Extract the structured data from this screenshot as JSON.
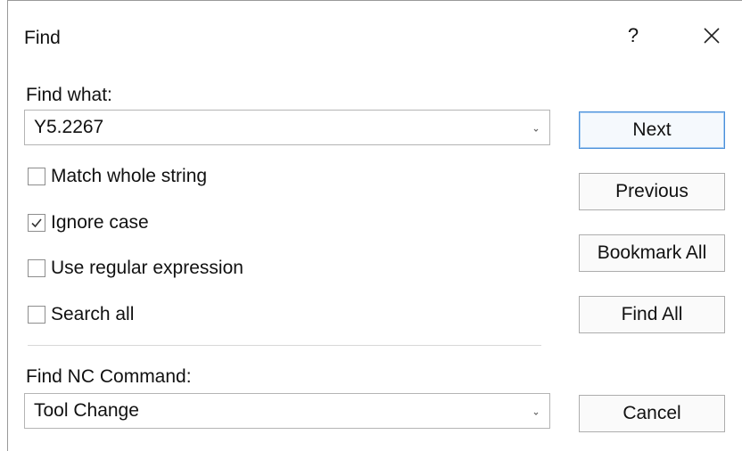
{
  "dialog": {
    "title": "Find",
    "help_label": "?"
  },
  "find_what": {
    "label": "Find what:",
    "value": "Y5.2267"
  },
  "options": [
    {
      "label": "Match whole string",
      "checked": false
    },
    {
      "label": "Ignore case",
      "checked": true
    },
    {
      "label": "Use regular expression",
      "checked": false
    },
    {
      "label": "Search all",
      "checked": false
    }
  ],
  "nc_command": {
    "label": "Find NC Command:",
    "value": "Tool Change"
  },
  "buttons": {
    "next": "Next",
    "previous": "Previous",
    "bookmark_all": "Bookmark All",
    "find_all": "Find All",
    "cancel": "Cancel"
  },
  "colors": {
    "default_button_border": "#4a8fd9",
    "checkmark": "#333333"
  }
}
